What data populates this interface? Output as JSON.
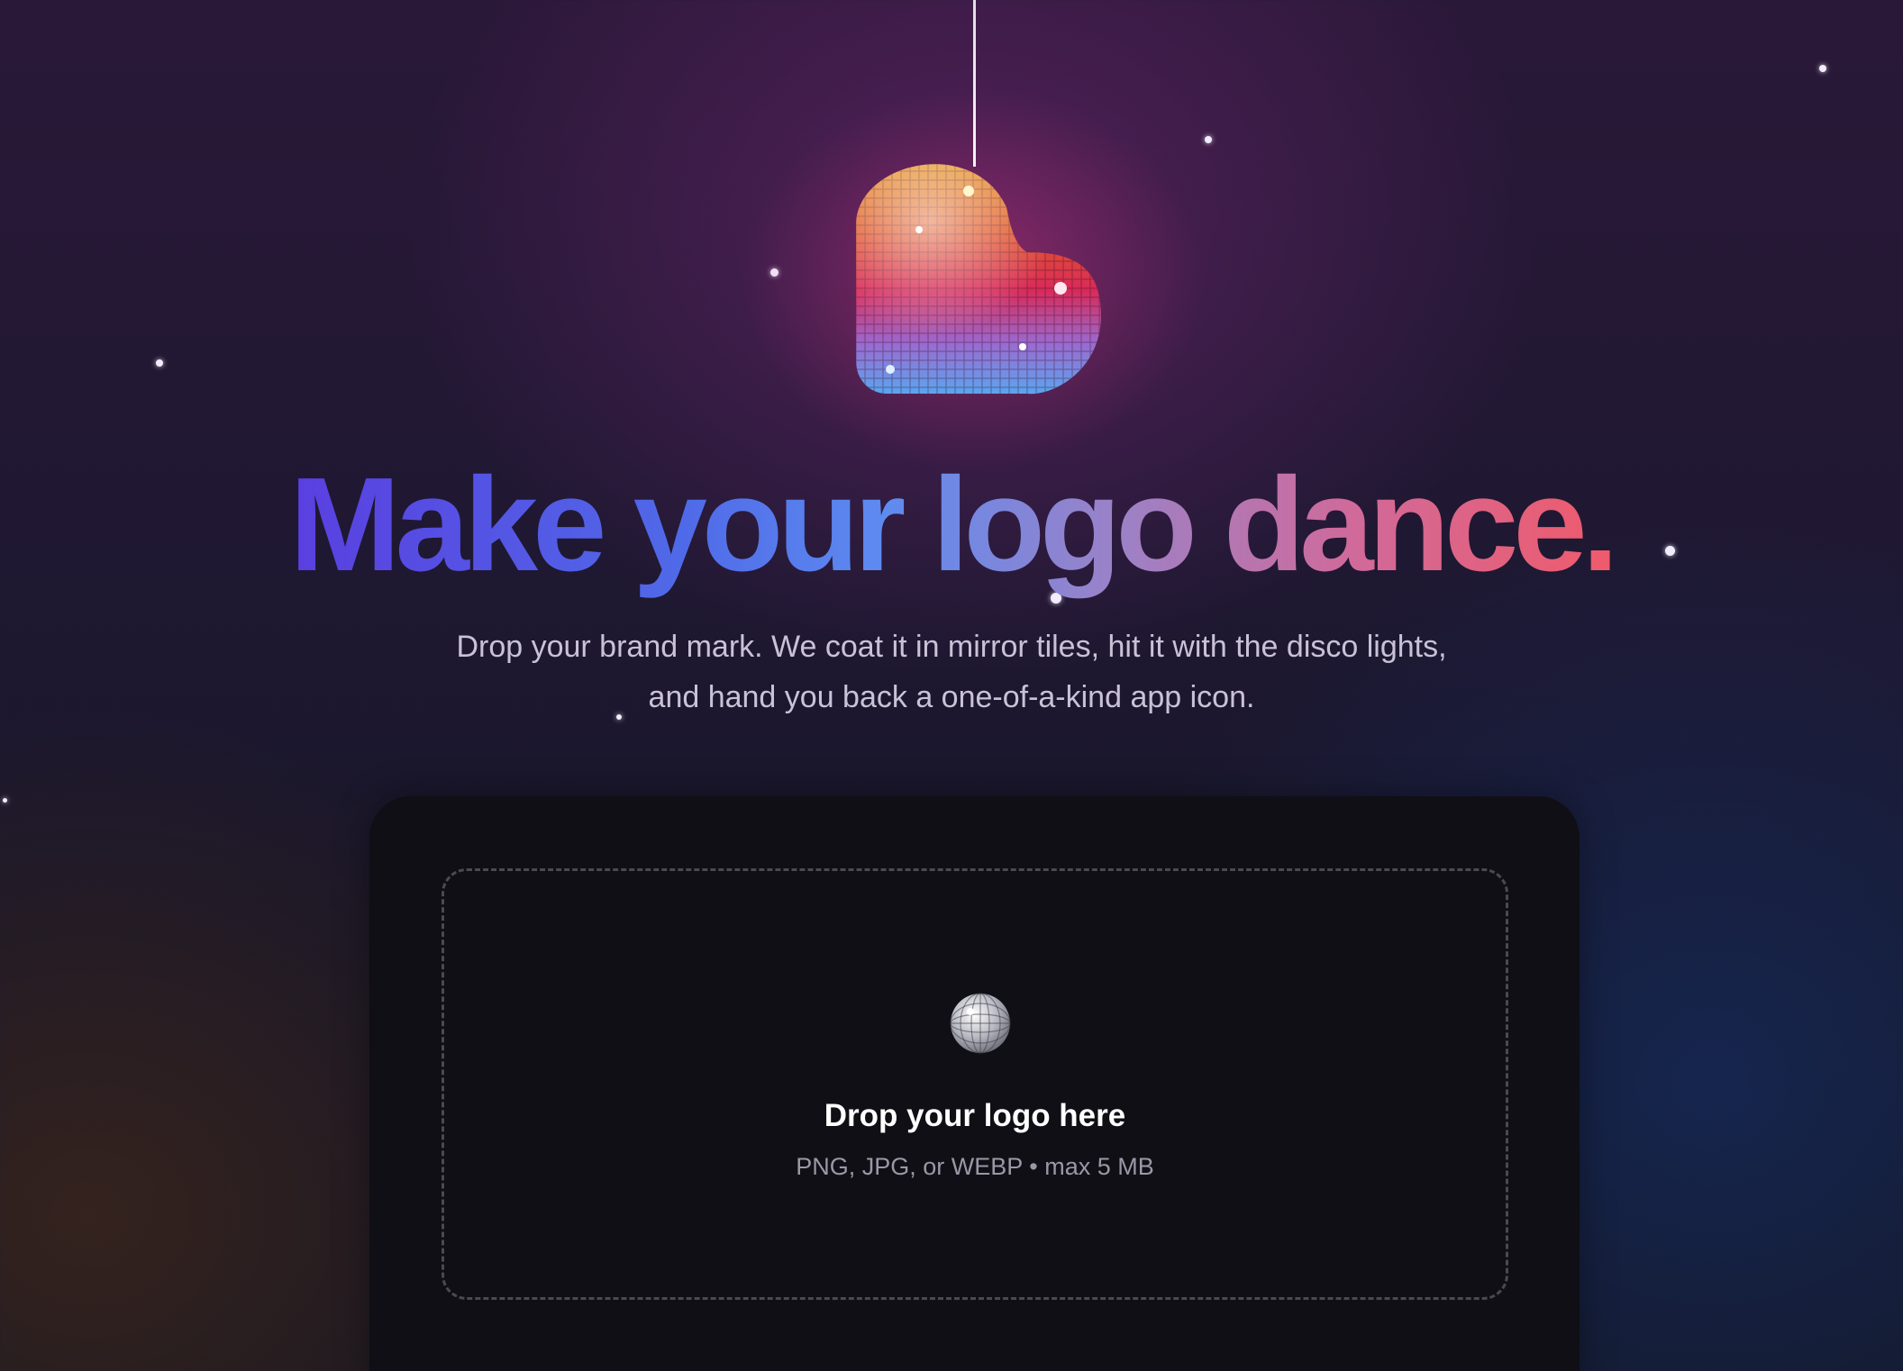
{
  "hero": {
    "headline": "Make your logo dance.",
    "subtitle_line1": "Drop your brand mark. We coat it in mirror tiles, hit it with the disco lights,",
    "subtitle_line2": "and hand you back a one-of-a-kind app icon.",
    "mascot_icon": "disco-heart-icon"
  },
  "upload": {
    "icon": "disco-ball-icon",
    "title": "Drop your logo here",
    "hint": "PNG, JPG, or WEBP • max 5 MB"
  },
  "colors": {
    "gradient_start": "#5a3ee0",
    "gradient_mid": "#5e8bf0",
    "gradient_end": "#f05a6a",
    "card_bg": "#0f0f15"
  }
}
